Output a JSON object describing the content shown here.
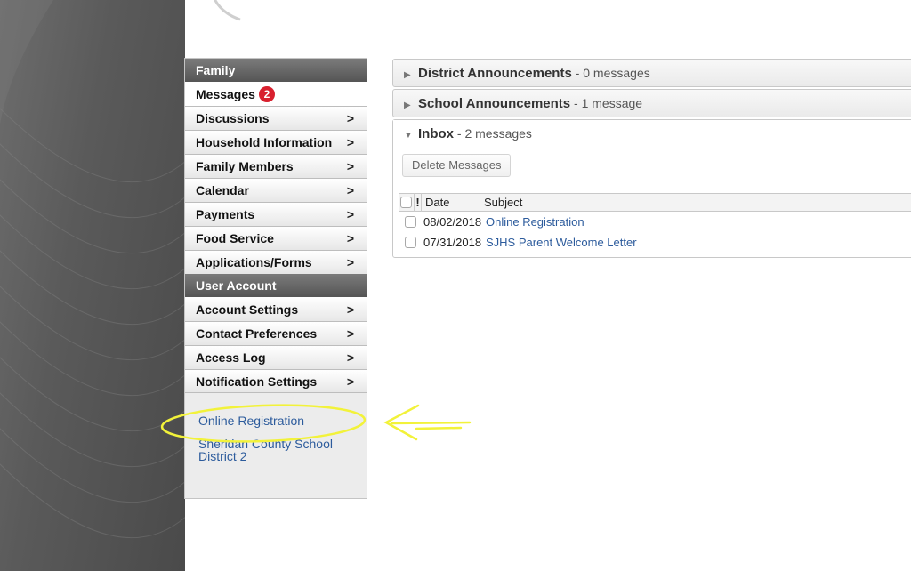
{
  "sidebar": {
    "family_header": "Family",
    "items": [
      {
        "label": "Messages",
        "badge": "2",
        "active": true
      },
      {
        "label": "Discussions"
      },
      {
        "label": "Household Information"
      },
      {
        "label": "Family Members"
      },
      {
        "label": "Calendar"
      },
      {
        "label": "Payments"
      },
      {
        "label": "Food Service"
      },
      {
        "label": "Applications/Forms"
      }
    ],
    "account_header": "User Account",
    "account_items": [
      {
        "label": "Account Settings"
      },
      {
        "label": "Contact Preferences"
      },
      {
        "label": "Access Log"
      },
      {
        "label": "Notification Settings"
      }
    ],
    "chevron": ">",
    "links": {
      "online_registration": "Online Registration",
      "district": "Sheridan County School District 2"
    }
  },
  "announcements": {
    "district": {
      "title": "District Announcements",
      "count": "- 0 messages"
    },
    "school": {
      "title": "School Announcements",
      "count": "- 1 message"
    }
  },
  "inbox": {
    "title": "Inbox",
    "count": "- 2 messages",
    "delete_label": "Delete Messages",
    "columns": {
      "flag": "!",
      "date": "Date",
      "subject": "Subject"
    },
    "rows": [
      {
        "date": "08/02/2018",
        "subject": "Online Registration"
      },
      {
        "date": "07/31/2018",
        "subject": "SJHS Parent Welcome Letter"
      }
    ]
  },
  "colors": {
    "link": "#2c5b9c",
    "badge": "#d8202e",
    "annotation": "#f2f23a"
  },
  "icons": {
    "collapsed": "triangle-right-icon",
    "expanded": "triangle-down-icon",
    "nav": "chevron-right-icon",
    "annotation_arrow": "arrow-left-icon"
  }
}
